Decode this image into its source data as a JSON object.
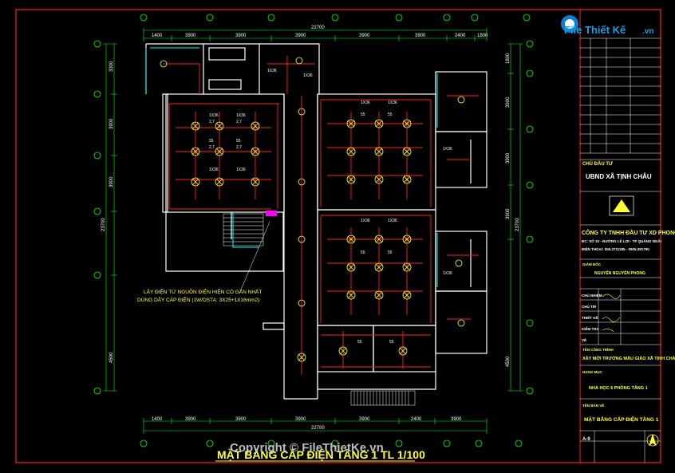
{
  "watermark": {
    "brand": "File Thiết Kế",
    "tld": ".vn",
    "copyright": "Copyright © FileThietKe.vn"
  },
  "drawing": {
    "title": "MẶT BẰNG CẤP ĐIỆN TẦNG 1 TL 1/100",
    "top_dims": [
      "1400",
      "3900",
      "3900",
      "3900",
      "3900",
      "3900",
      "2400",
      "1800"
    ],
    "top_total": "22700",
    "bottom_dims": [
      "1400",
      "3900",
      "3900",
      "3900",
      "3900",
      "2400",
      "3900"
    ],
    "bottom_total": "22700",
    "left_dims": [
      "3300",
      "3900",
      "3900",
      "4500"
    ],
    "left_total": "23700",
    "right_dims": [
      "1800",
      "3900",
      "3900",
      "3900",
      "4500"
    ],
    "right_total": "23700",
    "note_line1": "LẤY ĐIỆN TỪ NGUỒN ĐIỆN HIỆN CÓ GẦN NHẤT",
    "note_line2": "DÙNG DÂY CÁP ĐIỆN (1W/DSTA: 3X25+1X16mm2)",
    "fixture_label": "1X36",
    "fixture_value": "2,7",
    "fan_label": "55",
    "fan_value": "2,7"
  },
  "title_block": {
    "owner_label": "CHỦ ĐẦU TƯ",
    "owner": "UBND XÃ TỊNH CHÂU",
    "company": "CÔNG TY TNHH ĐẦU TƯ XD PHONG VÂN",
    "address": "ĐC: SỐ 10 - ĐƯỜNG LÊ LỢI - TP QUẢNG NGÃI",
    "phone": "ĐIỆN THOẠI: 055.3711185 - 0905.391790",
    "director_label": "GIÁM ĐỐC",
    "director": "NGUYỄN NGUYÊN PHONG",
    "rows": [
      "CHỦ NHIỆM",
      "CHỦ TRÌ",
      "THIẾT KẾ",
      "KIỂM TRA",
      "VẼ"
    ],
    "project_label": "TÊN CÔNG TRÌNH",
    "project": "XÂY MỚI TRƯỜNG MẪU GIÁO XÃ TỊNH CHÂU",
    "item_label": "HẠNG MỤC",
    "item": "NHÀ HỌC 6 PHÒNG TẦNG 1",
    "sheet_label": "TÊN BẢN VẼ",
    "sheet": "MẶT BẰNG CẤP ĐIỆN TẦNG 1",
    "sheet_no": "A-9"
  },
  "colors": {
    "background": "#000000",
    "frame": "#ff2020",
    "wall": "#ffffff",
    "wiring": "#ff2020",
    "fixture": "#ffff33",
    "dimension": "#00ff00",
    "cyan": "#00ffff",
    "magenta": "#ff00ff"
  }
}
